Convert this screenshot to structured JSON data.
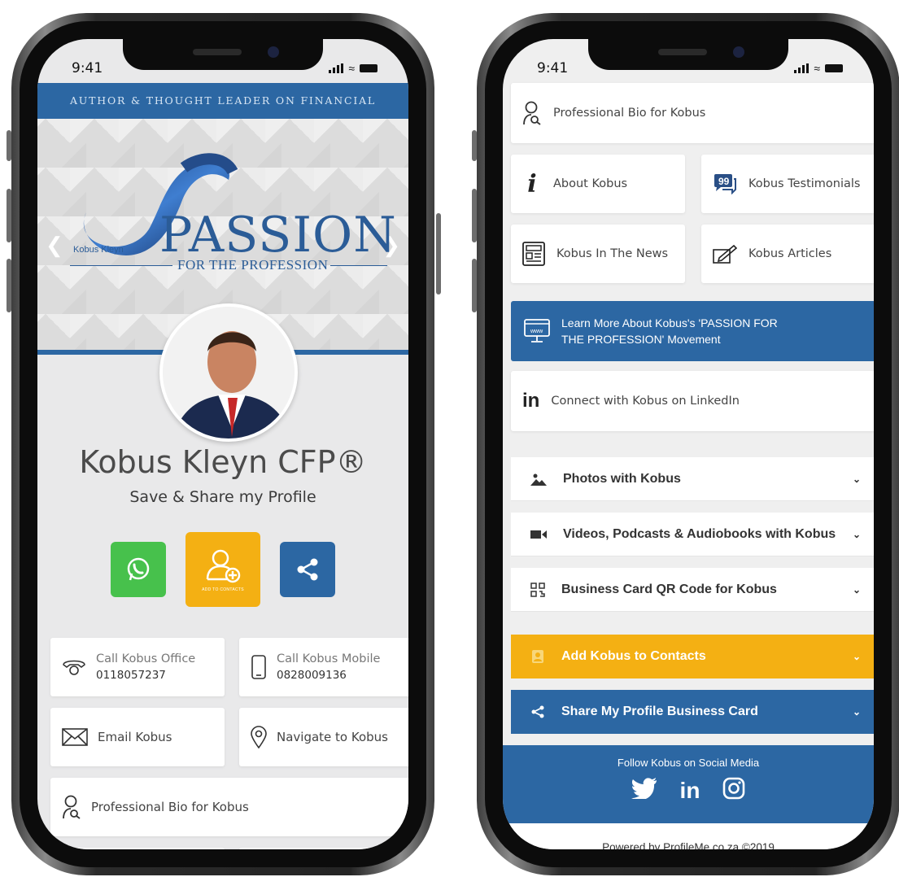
{
  "status": {
    "time": "9:41"
  },
  "left": {
    "tagline": "AUTHOR & THOUGHT LEADER ON FINANCIAL SERVICES",
    "logo": {
      "title": "PASSION",
      "subtitle": "FOR THE PROFESSION",
      "owner": "Kobus Kleyn"
    },
    "name": "Kobus Kleyn CFP®",
    "subtitle": "Save & Share my Profile",
    "add_contacts_label": "ADD TO CONTACTS",
    "tiles": {
      "call_office_label": "Call Kobus Office",
      "call_office_number": "0118057237",
      "call_mobile_label": "Call Kobus Mobile",
      "call_mobile_number": "0828009136",
      "email": "Email Kobus",
      "navigate": "Navigate to Kobus",
      "bio": "Professional Bio for Kobus"
    }
  },
  "right": {
    "bio": "Professional Bio for Kobus",
    "about": "About Kobus",
    "testimonials": "Kobus Testimonials",
    "news": "Kobus In The News",
    "articles": "Kobus Articles",
    "banner_line1": "Learn More About Kobus's 'PASSION FOR",
    "banner_line2": "THE PROFESSION' Movement",
    "linkedin": "Connect with Kobus on LinkedIn",
    "accordions": {
      "photos": "Photos with Kobus",
      "videos": "Videos, Podcasts & Audiobooks with Kobus",
      "qr": "Business Card QR Code for Kobus",
      "add": "Add Kobus to Contacts",
      "share": "Share My Profile Business Card"
    },
    "follow": "Follow Kobus on Social Media",
    "powered": "Powered by ProfileMe.co.za ©2019"
  },
  "colors": {
    "brand_blue": "#2c67a3",
    "whatsapp_green": "#47c14c",
    "accent_yellow": "#f4b013"
  },
  "icons": [
    "phone-icon",
    "mobile-icon",
    "mail-icon",
    "location-pin-icon",
    "user-search-icon",
    "info-icon",
    "quote-bubble-icon",
    "newspaper-icon",
    "pencil-icon",
    "browser-icon",
    "linkedin-icon",
    "image-icon",
    "video-icon",
    "qr-code-icon",
    "contact-card-icon",
    "share-icon",
    "twitter-icon",
    "instagram-icon",
    "whatsapp-icon",
    "add-contact-icon"
  ]
}
